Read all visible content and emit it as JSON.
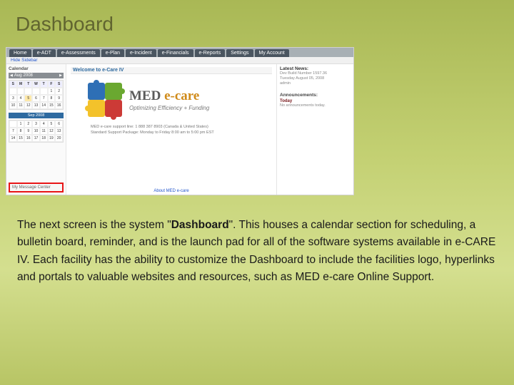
{
  "slide": {
    "title": "Dashboard"
  },
  "app": {
    "tabs": [
      "Home",
      "e-ADT",
      "e-Assessments",
      "e-Plan",
      "e-Incident",
      "e-Financials",
      "e-Reports",
      "Settings",
      "My Account"
    ],
    "subbar": "Hide Sidebar",
    "sidebar": {
      "label": "Calendar",
      "month1": "Aug",
      "year1": "2008",
      "month2": "Sep 2008",
      "msg_center": "My Message Center"
    },
    "main": {
      "header": "Welcome to e-Care IV",
      "brand_med": "MED",
      "brand_ecare": " e-care",
      "brand_tag": "Optimizing Efficiency + Funding",
      "support_line1": "MED e-care support line: 1 888 387 8903 (Canada & United States)",
      "support_line2": "Standard Support Package: Monday to Friday 8:00 am to 5:00 pm EST",
      "about": "About MED e-care"
    },
    "right": {
      "label": "Latest News:",
      "build": "Dev Build Number 1597.36",
      "date": "Tuesday August 05, 2008",
      "user": "admin",
      "ann_label": "Announcements:",
      "today_label": "Today",
      "today_text": "No announcements today."
    }
  },
  "body": {
    "p1_a": "The next screen is the system \"",
    "p1_bold": "Dashboard",
    "p1_b": "\".  This houses a calendar section for scheduling, a bulletin board, reminder, and is the launch pad for all of the software systems available in e-CARE IV. Each facility has the ability to customize the Dashboard to include the facilities logo, hyperlinks and portals to valuable websites and resources, such as MED e-care Online Support."
  }
}
